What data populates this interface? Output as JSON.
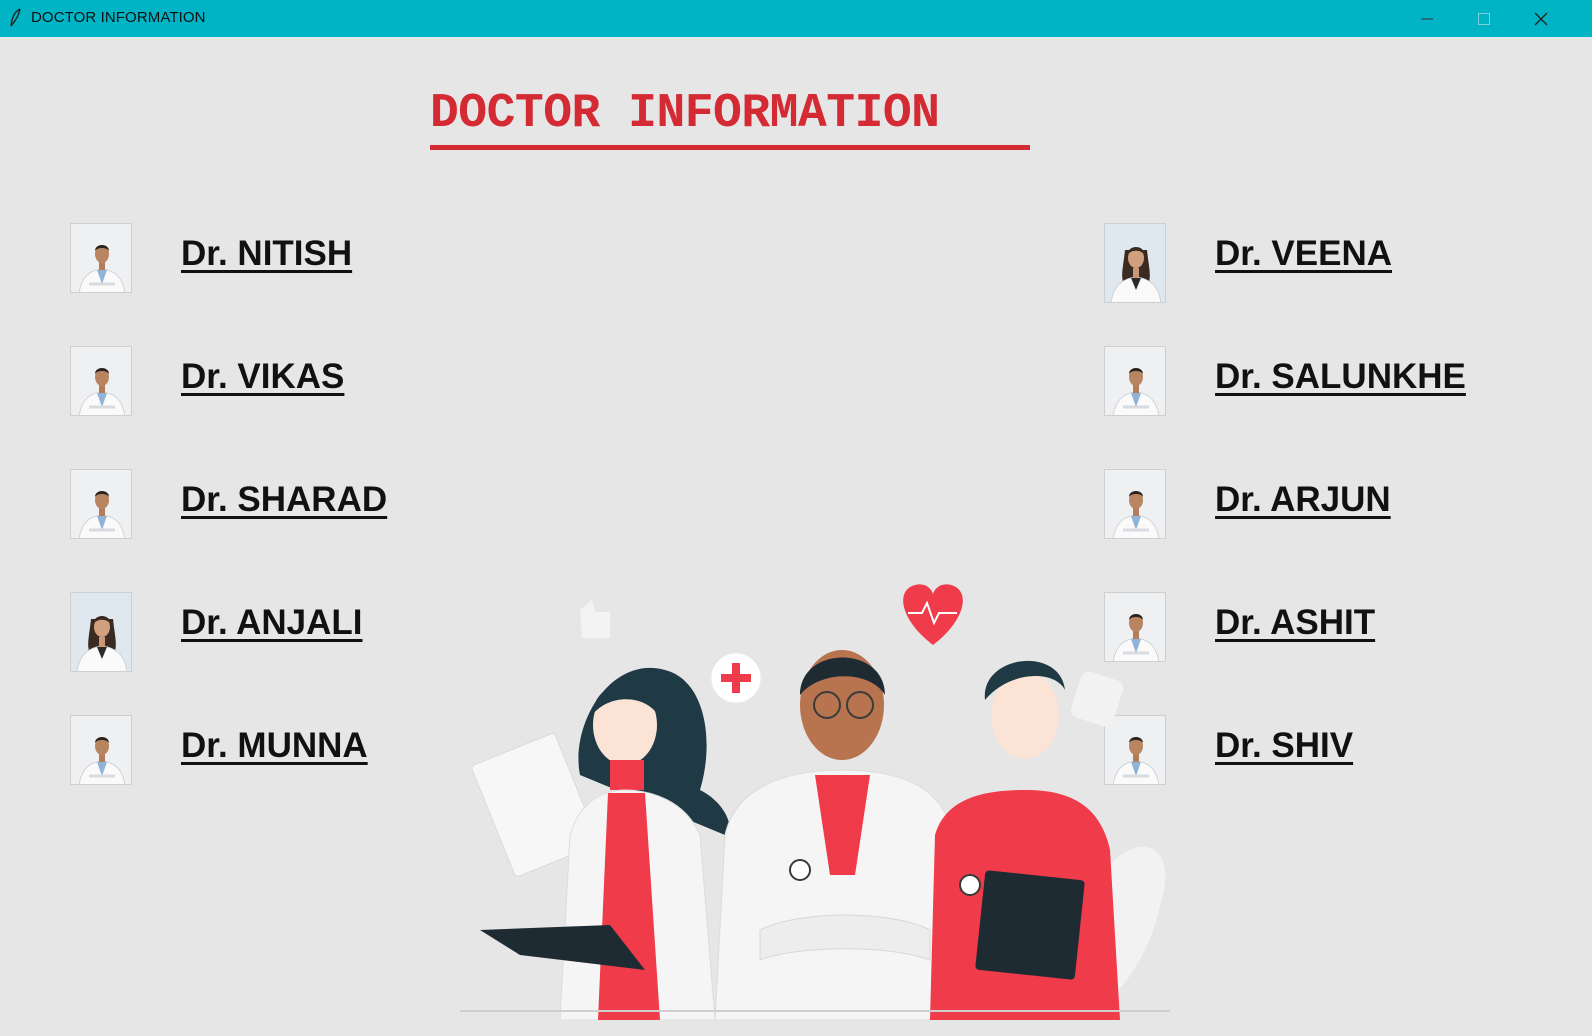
{
  "window": {
    "title": "DOCTOR INFORMATION"
  },
  "page": {
    "heading": "DOCTOR INFORMATION"
  },
  "colors": {
    "titlebar": "#00b4c6",
    "heading": "#d32a33",
    "background": "#e6e6e6",
    "accent_red": "#ef3b4a"
  },
  "doctors_left": [
    {
      "name": "Dr. NITISH",
      "photo": "male-doctor"
    },
    {
      "name": "Dr. VIKAS",
      "photo": "male-doctor"
    },
    {
      "name": "Dr. SHARAD",
      "photo": "male-doctor"
    },
    {
      "name": "Dr. ANJALI",
      "photo": "female-doctor"
    },
    {
      "name": "Dr. MUNNA",
      "photo": "male-doctor"
    }
  ],
  "doctors_right": [
    {
      "name": "Dr. VEENA",
      "photo": "female-doctor"
    },
    {
      "name": "Dr. SALUNKHE",
      "photo": "male-doctor"
    },
    {
      "name": "Dr. ARJUN",
      "photo": "male-doctor"
    },
    {
      "name": "Dr. ASHIT",
      "photo": "male-doctor"
    },
    {
      "name": "Dr. SHIV",
      "photo": "male-doctor"
    }
  ],
  "icons": {
    "app": "feather-icon",
    "minimize": "minimize-icon",
    "maximize": "maximize-icon",
    "close": "close-icon"
  }
}
